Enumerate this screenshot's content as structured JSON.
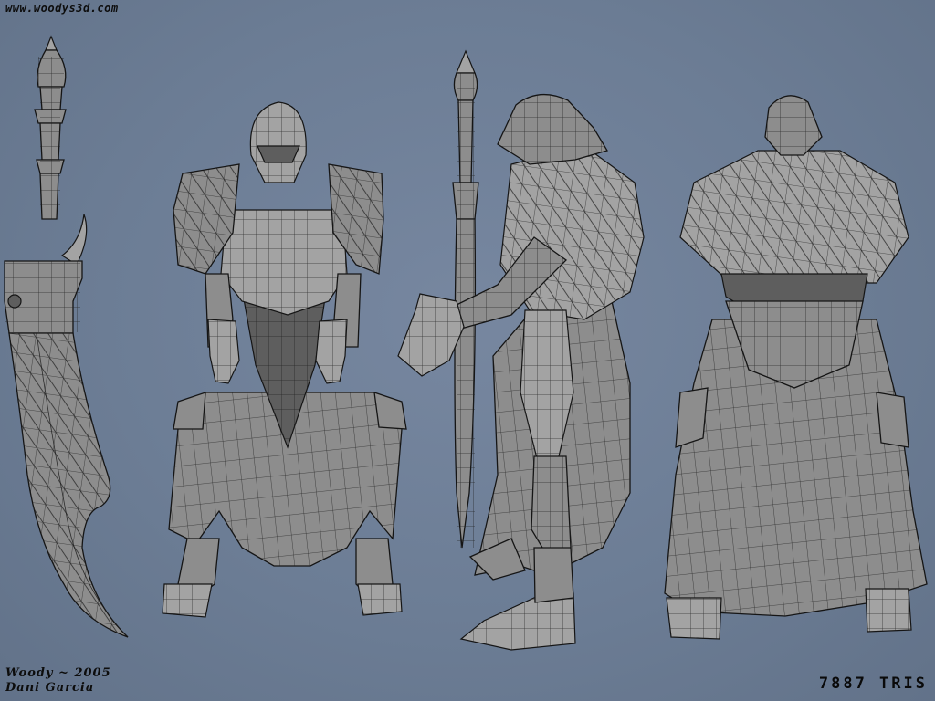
{
  "header": {
    "site_url": "www.woodys3d.com"
  },
  "footer": {
    "credit_line1": "Woody ~ 2005",
    "credit_line2": "Dani Garcia",
    "triangle_count": "7887 TRIS"
  },
  "colors": {
    "background": "#6e7f96",
    "mesh_fill": "#8d8d8d",
    "wireframe": "#151515",
    "text": "#0d0d0d"
  }
}
